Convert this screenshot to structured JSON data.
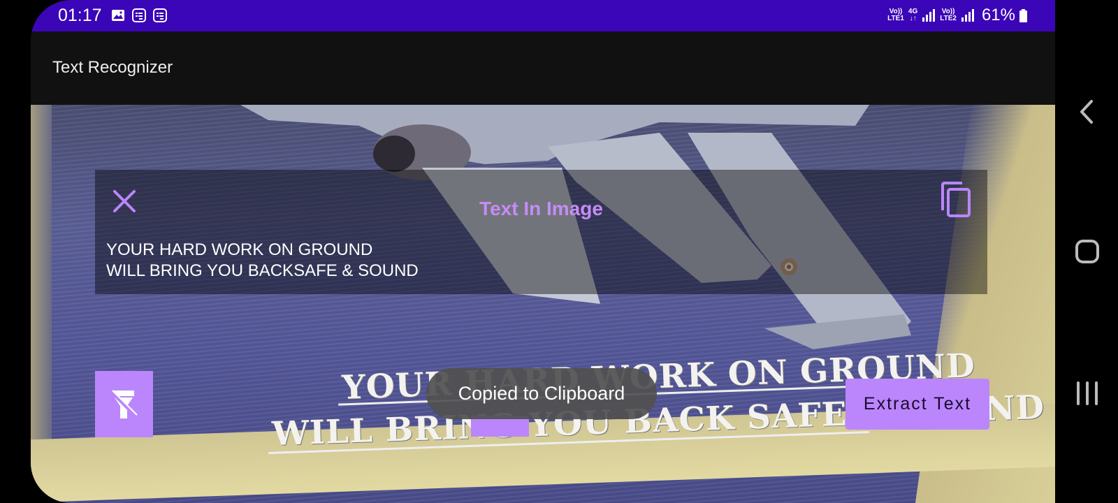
{
  "status_bar": {
    "time": "01:17",
    "network_1": {
      "top": "Vo))",
      "bottom": "LTE1"
    },
    "network_type": {
      "top": "4G",
      "bottom": "↓↑"
    },
    "network_2": {
      "top": "Vo))",
      "bottom": "LTE2"
    },
    "battery": "61%",
    "icons": [
      "image-icon",
      "notification-icon",
      "notification-icon"
    ]
  },
  "app_bar": {
    "title": "Text Recognizer"
  },
  "camera": {
    "printed_line_1": "YOUR HARD WORK ON GROUND",
    "printed_line_2": "WILL BRING YOU BACK SAFE & SOUND"
  },
  "result_panel": {
    "title": "Text In Image",
    "recognized_text": "YOUR HARD WORK ON GROUND\nWILL BRING YOU BACKSAFE & SOUND"
  },
  "buttons": {
    "extract": "Extract Text"
  },
  "toast": "Copied to Clipboard",
  "colors": {
    "accent": "#bb86fc",
    "title": "#c58cf5",
    "status_bar": "#3b05b8"
  }
}
